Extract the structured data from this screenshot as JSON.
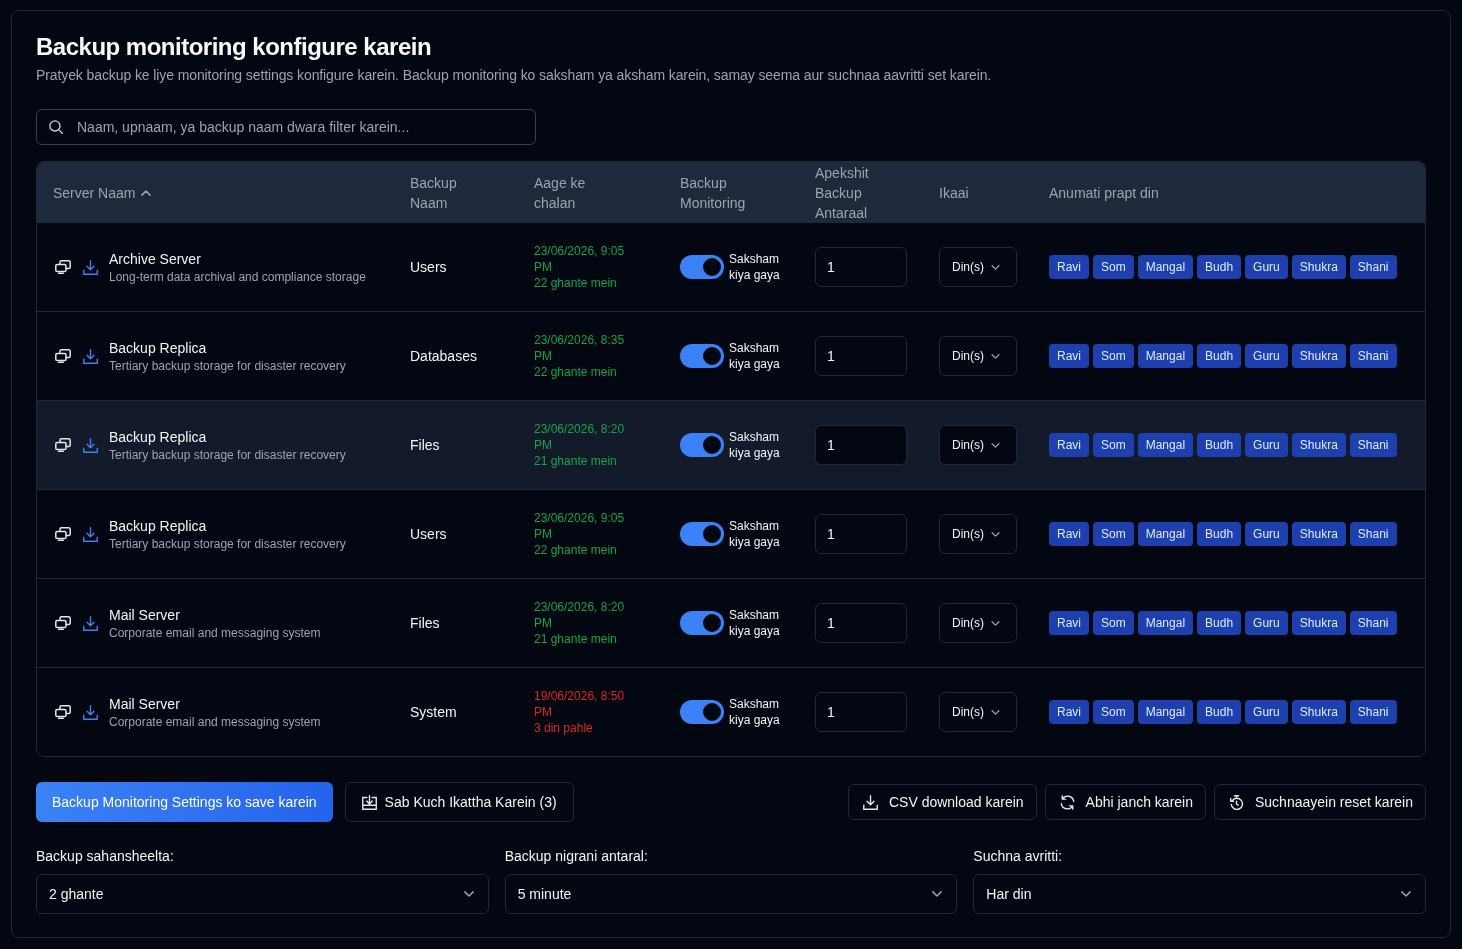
{
  "header": {
    "title": "Backup monitoring konfigure karein",
    "subtitle": "Pratyek backup ke liye monitoring settings konfigure karein. Backup monitoring ko saksham ya aksham karein, samay seema aur suchnaa aavritti set karein."
  },
  "search": {
    "placeholder": "Naam, upnaam, ya backup naam dwara filter karein..."
  },
  "table": {
    "columns": [
      {
        "label": "Server Naam",
        "sorted": true
      },
      {
        "label": "Backup Naam",
        "sorted": false
      },
      {
        "label": "Aage ke chalan",
        "sorted": false
      },
      {
        "label": "Backup Monitoring",
        "sorted": false
      },
      {
        "label": "Apekshit Backup Antaraal",
        "sorted": false
      },
      {
        "label": "Ikaai",
        "sorted": false
      },
      {
        "label": "Anumati prapt din",
        "sorted": false
      }
    ],
    "rows": [
      {
        "server_name": "Archive Server",
        "description": "Long-term data archival and compliance storage",
        "backup_name": "Users",
        "next_run": {
          "date": "23/06/2026, 9:05 PM",
          "relative": "22 ghante mein",
          "overdue": false
        },
        "monitoring": {
          "on": true,
          "label": "Saksham kiya gaya"
        },
        "interval": "1",
        "unit": "Din(s)",
        "hovered": false,
        "days": [
          {
            "label": "Ravi",
            "selected": true
          },
          {
            "label": "Som",
            "selected": true
          },
          {
            "label": "Mangal",
            "selected": true
          },
          {
            "label": "Budh",
            "selected": true
          },
          {
            "label": "Guru",
            "selected": true
          },
          {
            "label": "Shukra",
            "selected": true
          },
          {
            "label": "Shani",
            "selected": true
          }
        ]
      },
      {
        "server_name": "Backup Replica",
        "description": "Tertiary backup storage for disaster recovery",
        "backup_name": "Databases",
        "next_run": {
          "date": "23/06/2026, 8:35 PM",
          "relative": "22 ghante mein",
          "overdue": false
        },
        "monitoring": {
          "on": true,
          "label": "Saksham kiya gaya"
        },
        "interval": "1",
        "unit": "Din(s)",
        "hovered": false,
        "days": [
          {
            "label": "Ravi",
            "selected": true
          },
          {
            "label": "Som",
            "selected": true
          },
          {
            "label": "Mangal",
            "selected": true
          },
          {
            "label": "Budh",
            "selected": true
          },
          {
            "label": "Guru",
            "selected": true
          },
          {
            "label": "Shukra",
            "selected": true
          },
          {
            "label": "Shani",
            "selected": true
          }
        ]
      },
      {
        "server_name": "Backup Replica",
        "description": "Tertiary backup storage for disaster recovery",
        "backup_name": "Files",
        "next_run": {
          "date": "23/06/2026, 8:20 PM",
          "relative": "21 ghante mein",
          "overdue": false
        },
        "monitoring": {
          "on": true,
          "label": "Saksham kiya gaya"
        },
        "interval": "1",
        "unit": "Din(s)",
        "hovered": true,
        "days": [
          {
            "label": "Ravi",
            "selected": true
          },
          {
            "label": "Som",
            "selected": true
          },
          {
            "label": "Mangal",
            "selected": true
          },
          {
            "label": "Budh",
            "selected": true
          },
          {
            "label": "Guru",
            "selected": true
          },
          {
            "label": "Shukra",
            "selected": true
          },
          {
            "label": "Shani",
            "selected": true
          }
        ]
      },
      {
        "server_name": "Backup Replica",
        "description": "Tertiary backup storage for disaster recovery",
        "backup_name": "Users",
        "next_run": {
          "date": "23/06/2026, 9:05 PM",
          "relative": "22 ghante mein",
          "overdue": false
        },
        "monitoring": {
          "on": true,
          "label": "Saksham kiya gaya"
        },
        "interval": "1",
        "unit": "Din(s)",
        "hovered": false,
        "days": [
          {
            "label": "Ravi",
            "selected": true
          },
          {
            "label": "Som",
            "selected": true
          },
          {
            "label": "Mangal",
            "selected": true
          },
          {
            "label": "Budh",
            "selected": true
          },
          {
            "label": "Guru",
            "selected": true
          },
          {
            "label": "Shukra",
            "selected": true
          },
          {
            "label": "Shani",
            "selected": true
          }
        ]
      },
      {
        "server_name": "Mail Server",
        "description": "Corporate email and messaging system",
        "backup_name": "Files",
        "next_run": {
          "date": "23/06/2026, 8:20 PM",
          "relative": "21 ghante mein",
          "overdue": false
        },
        "monitoring": {
          "on": true,
          "label": "Saksham kiya gaya"
        },
        "interval": "1",
        "unit": "Din(s)",
        "hovered": false,
        "days": [
          {
            "label": "Ravi",
            "selected": true
          },
          {
            "label": "Som",
            "selected": true
          },
          {
            "label": "Mangal",
            "selected": true
          },
          {
            "label": "Budh",
            "selected": true
          },
          {
            "label": "Guru",
            "selected": true
          },
          {
            "label": "Shukra",
            "selected": true
          },
          {
            "label": "Shani",
            "selected": true
          }
        ]
      },
      {
        "server_name": "Mail Server",
        "description": "Corporate email and messaging system",
        "backup_name": "System",
        "next_run": {
          "date": "19/06/2026, 8:50 PM",
          "relative": "3 din pahle",
          "overdue": true
        },
        "monitoring": {
          "on": true,
          "label": "Saksham kiya gaya"
        },
        "interval": "1",
        "unit": "Din(s)",
        "hovered": false,
        "days": [
          {
            "label": "Ravi",
            "selected": true
          },
          {
            "label": "Som",
            "selected": true
          },
          {
            "label": "Mangal",
            "selected": true
          },
          {
            "label": "Budh",
            "selected": true
          },
          {
            "label": "Guru",
            "selected": true
          },
          {
            "label": "Shukra",
            "selected": true
          },
          {
            "label": "Shani",
            "selected": true
          }
        ]
      }
    ]
  },
  "actions": {
    "left": [
      {
        "label": "Backup Monitoring Settings ko save karein",
        "kind": "primary"
      },
      {
        "label": "Sab Kuch Ikattha Karein (3)",
        "kind": "collect"
      }
    ],
    "right": [
      {
        "label": "CSV download karein",
        "kind": "download"
      },
      {
        "label": "Abhi janch karein",
        "kind": "refresh"
      },
      {
        "label": "Suchnaayein reset karein",
        "kind": "reset"
      }
    ]
  },
  "settings": [
    {
      "label": "Backup sahansheelta:",
      "value": "2 ghante"
    },
    {
      "label": "Backup nigrani antaral:",
      "value": "5 minute"
    },
    {
      "label": "Suchna avritti:",
      "value": "Har din"
    }
  ]
}
